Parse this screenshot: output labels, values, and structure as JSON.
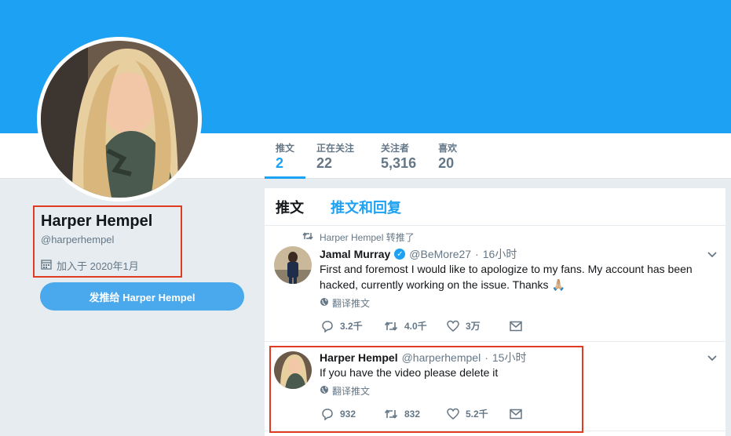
{
  "colors": {
    "banner": "#1da1f2",
    "accent": "#1da1f2",
    "highlight": "#e03c24",
    "tweet_button": "#4aa8ec"
  },
  "nav": {
    "stats": [
      {
        "label": "推文",
        "value": "2",
        "active": true
      },
      {
        "label": "正在关注",
        "value": "22",
        "active": false
      },
      {
        "label": "关注者",
        "value": "5,316",
        "active": false
      },
      {
        "label": "喜欢",
        "value": "20",
        "active": false
      }
    ]
  },
  "profile": {
    "name": "Harper Hempel",
    "handle": "@harperhempel",
    "joined": "加入于 2020年1月",
    "tweet_to_label": "发推给 Harper Hempel"
  },
  "timeline": {
    "tabs": [
      {
        "label": "推文",
        "active": true
      },
      {
        "label": "推文和回复",
        "active": false
      }
    ],
    "tweets": [
      {
        "retweeted_by": "Harper Hempel 转推了",
        "name": "Jamal Murray",
        "verified": true,
        "handle": "@BeMore27",
        "time": "16小时",
        "text": "First and foremost I would like to apologize to my fans. My account has been hacked, currently working on the issue. Thanks 🙏🏼",
        "translate": "翻译推文",
        "replies": "3.2千",
        "retweets": "4.0千",
        "likes": "3万"
      },
      {
        "name": "Harper Hempel",
        "verified": false,
        "handle": "@harperhempel",
        "time": "15小时",
        "text": "If you have the video please delete it",
        "translate": "翻译推文",
        "replies": "932",
        "retweets": "832",
        "likes": "5.2千"
      }
    ]
  }
}
